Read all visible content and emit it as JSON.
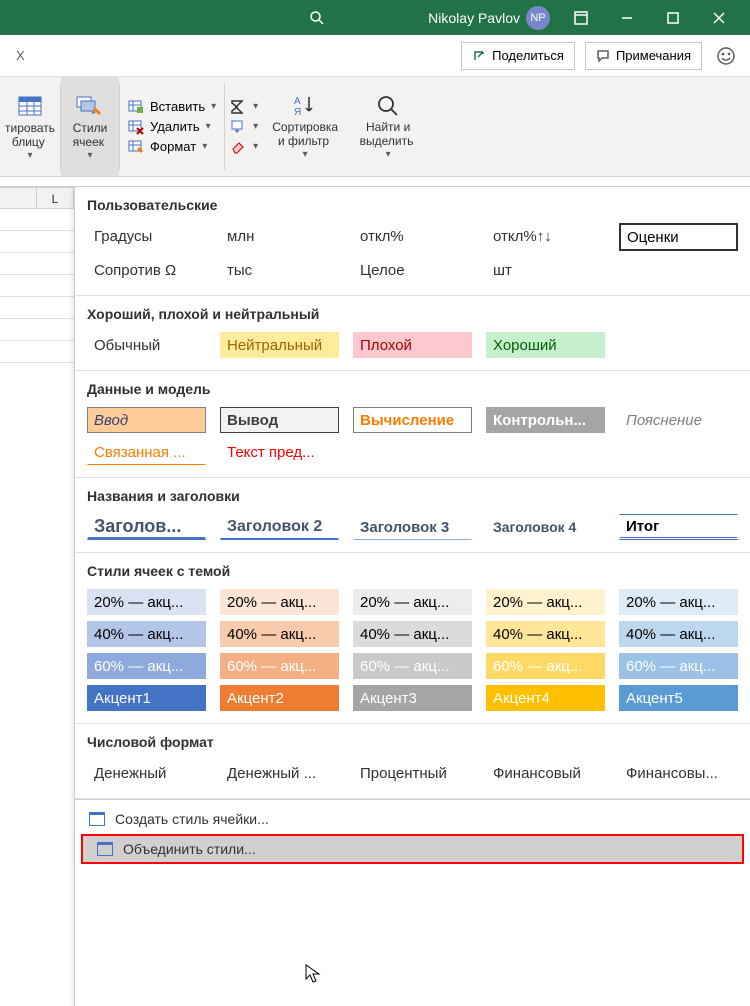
{
  "titlebar": {
    "user_name": "Nikolay Pavlov",
    "initials": "NP"
  },
  "subbar": {
    "share": "Поделиться",
    "comments": "Примечания",
    "x_label": "X"
  },
  "ribbon": {
    "format_table": "тировать\nблицу ",
    "cell_styles": "Стили\nячеек ",
    "insert": "Вставить",
    "delete": "Удалить",
    "format": "Формат",
    "sort_filter": "Сортировка\nи фильтр ",
    "find_select": "Найти и\nвыделить "
  },
  "gallery": {
    "sec_custom": "Пользовательские",
    "custom_row1": [
      "Градусы",
      "млн",
      "откл%",
      "откл%↑↓"
    ],
    "searchbox": "Оценки",
    "custom_row2": [
      "Сопротив Ω",
      "тыс",
      "Целое",
      "шт"
    ],
    "sec_gbn": "Хороший, плохой и нейтральный",
    "gbn": [
      "Обычный",
      "Нейтральный",
      "Плохой",
      "Хороший"
    ],
    "sec_data": "Данные и модель",
    "data_r1": [
      "Ввод",
      "Вывод",
      "Вычисление",
      "Контрольн...",
      "Пояснение"
    ],
    "data_r2": [
      "Связанная ...",
      "Текст пред..."
    ],
    "sec_head": "Названия и заголовки",
    "head": [
      "Заголов...",
      "Заголовок 2",
      "Заголовок 3",
      "Заголовок 4",
      "Итог"
    ],
    "sec_themed": "Стили ячеек с темой",
    "themed_20": [
      "20% — акц...",
      "20% — акц...",
      "20% — акц...",
      "20% — акц...",
      "20% — акц..."
    ],
    "themed_40": [
      "40% — акц...",
      "40% — акц...",
      "40% — акц...",
      "40% — акц...",
      "40% — акц..."
    ],
    "themed_60": [
      "60% — акц...",
      "60% — акц...",
      "60% — акц...",
      "60% — акц...",
      "60% — акц..."
    ],
    "themed_acc": [
      "Акцент1",
      "Акцент2",
      "Акцент3",
      "Акцент4",
      "Акцент5"
    ],
    "sec_num": "Числовой формат",
    "num": [
      "Денежный",
      "Денежный ...",
      "Процентный",
      "Финансовый",
      "Финансовы..."
    ],
    "menu_new": "Создать стиль ячейки...",
    "menu_merge": "Объединить стили..."
  },
  "sheet": {
    "col": "L"
  }
}
